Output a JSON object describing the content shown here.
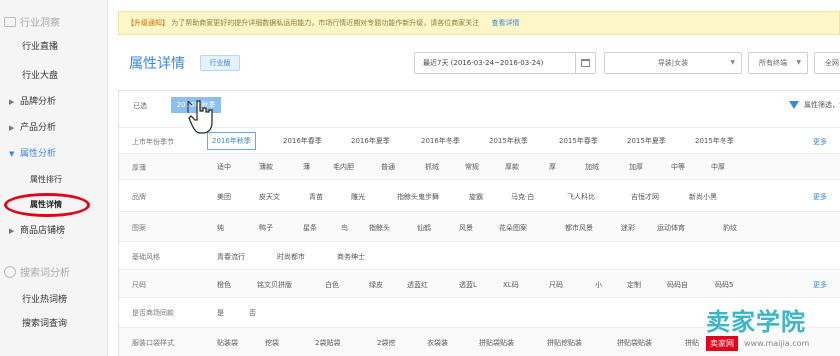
{
  "sidebar": {
    "heading1": "行业洞察",
    "items": [
      {
        "label": "行业直播"
      },
      {
        "label": "行业大盘"
      },
      {
        "label": "品牌分析"
      },
      {
        "label": "产品分析"
      },
      {
        "label": "属性分析"
      },
      {
        "label": "属性排行"
      },
      {
        "label": "属性详情"
      },
      {
        "label": "商品店铺榜"
      }
    ],
    "heading2": "搜索词分析",
    "items2": [
      {
        "label": "行业热词榜"
      },
      {
        "label": "搜索词查询"
      }
    ]
  },
  "notice": {
    "tag": "【升级通知】",
    "text": "为了帮助商家更好的提升详细数据私运用能力，市场行情近期对专题功能作新升级，请各位商家关注",
    "link": "查看详情"
  },
  "header": {
    "title": "属性详情",
    "badge": "行业版",
    "date_range": "最近7天 (2016-03-24~2016-03-24)",
    "select1": "导装|女装",
    "select2": "所有终端",
    "select3": "全网"
  },
  "filter": {
    "selected_label": "已选",
    "selected_chip": "2016年秋季",
    "filter_right": "属性筛选，请选择",
    "more": "更多",
    "rows": [
      {
        "label": "上市年份季节",
        "options": [
          "2016年秋季",
          "2016年春季",
          "2016年夏季",
          "2016年冬季",
          "2015年秋季",
          "2015年春季",
          "2015年夏季",
          "2015年冬季"
        ]
      },
      {
        "label": "厚薄",
        "options": [
          "适中",
          "薄款",
          "薄",
          "毛内胆",
          "普通",
          "抓绒",
          "常规",
          "厚款",
          "厚",
          "加绒",
          "加厚",
          "中等",
          "中厚"
        ]
      },
      {
        "label": "品牌",
        "options": [
          "美团",
          "皮天文",
          "青苗",
          "雕光",
          "指鲸头鬼步舞",
          "旋霸",
          "马克·白",
          "飞人科比",
          "吉恒才网",
          "新尚小黑"
        ]
      },
      {
        "label": "图案",
        "options": [
          "纯",
          "鸭子",
          "星条",
          "鸟",
          "指鲸头",
          "仙鹤",
          "风景",
          "花朵图案",
          "都市风景",
          "迷彩",
          "运动体育",
          "豹纹"
        ]
      },
      {
        "label": "基础风格",
        "options": [
          "青春流行",
          "时尚都市",
          "商务绅士"
        ]
      },
      {
        "label": "尺码",
        "options": [
          "橙色",
          "铭文贝拼版",
          "白色",
          "绿皮",
          "透蓝红",
          "透蓝L",
          "XL码",
          "尺码",
          "小",
          "定制",
          "码码自",
          "码码5"
        ]
      },
      {
        "label": "是否商场同款",
        "options": [
          "是",
          "否"
        ]
      },
      {
        "label": "服装口袋样式",
        "options": [
          "贴装袋",
          "挖袋",
          "2袋贴袋",
          "2袋挖",
          "衣袋装",
          "拼贴袋贴装",
          "拼贴挖贴装",
          "拼贴袋贴装",
          "拼贴"
        ]
      }
    ]
  },
  "watermark": {
    "title": "卖家学院",
    "badge": "卖家网",
    "url": "www.maijia.com"
  },
  "colors": {
    "accent": "#3a88d6",
    "notice_bg": "#fdf6c6",
    "highlight": "#e3001b",
    "chip": "#8ec0ee"
  }
}
